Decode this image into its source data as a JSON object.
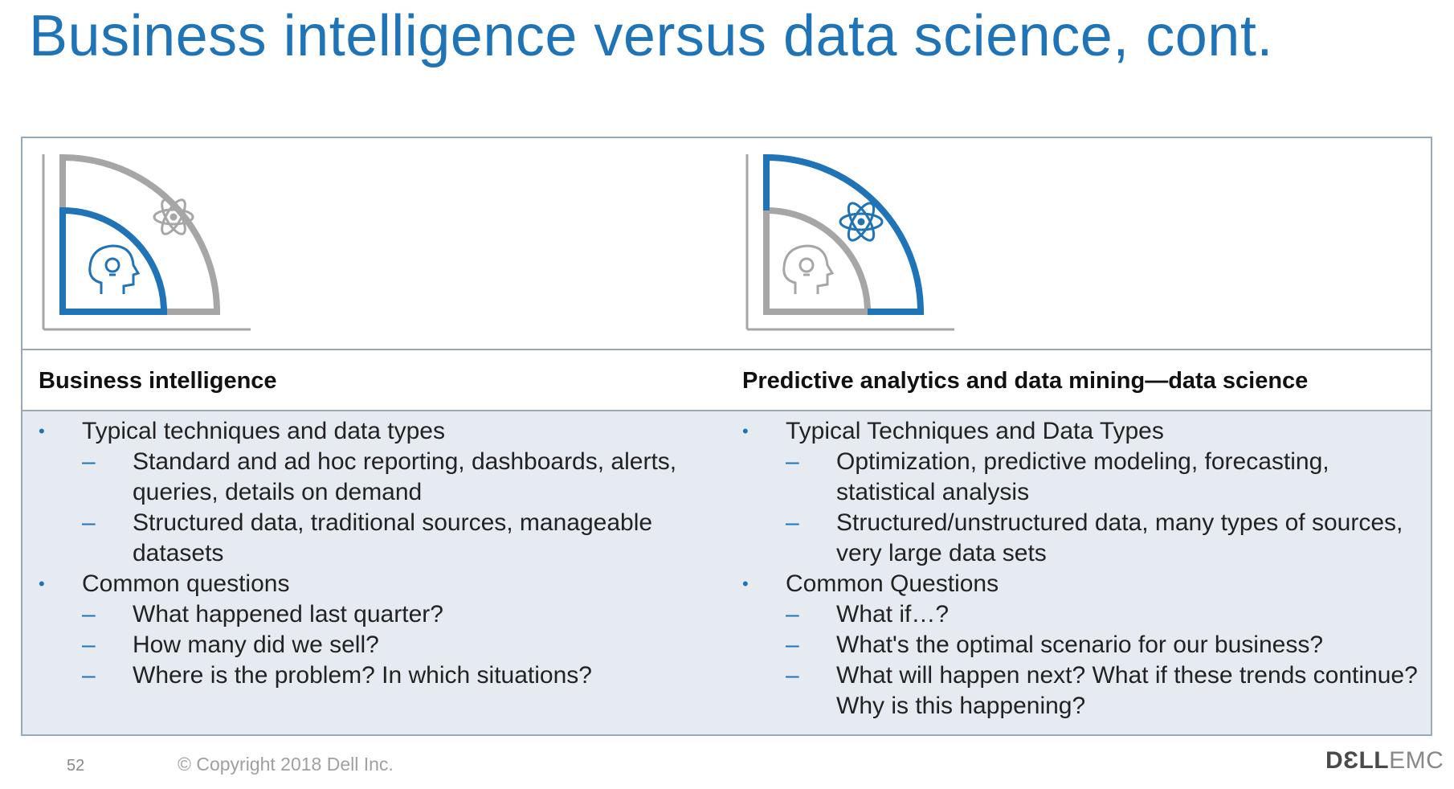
{
  "title": "Business intelligence versus data science, cont.",
  "colors": {
    "accent": "#1f73b7",
    "gray": "#a6a6a6",
    "band": "#e6ebf1"
  },
  "left": {
    "heading": "Business intelligence",
    "icon": "bi-quadrant-icon",
    "items": [
      {
        "text": "Typical techniques  and data types",
        "subitems": [
          "Standard and ad hoc reporting, dashboards, alerts, queries, details on demand",
          "Structured  data, traditional sources, manageable datasets"
        ]
      },
      {
        "text": "Common questions",
        "subitems": [
          "What happened last quarter?",
          "How many  did we sell?",
          "Where is the problem? In  which  situations?"
        ]
      }
    ]
  },
  "right": {
    "heading": "Predictive analytics and data mining—data science",
    "icon": "data-science-quadrant-icon",
    "items": [
      {
        "text": "Typical Techniques  and Data Types",
        "subitems": [
          "Optimization,  predictive modeling, forecasting, statistical analysis",
          "Structured/unstructured  data, many types of sources, very large data sets"
        ]
      },
      {
        "text": "Common Questions",
        "subitems": [
          "What if…?",
          "What's the optimal scenario for our business?",
          "What will happen next? What if these trends continue? Why is this happening?"
        ]
      }
    ]
  },
  "footer": {
    "page_number": "52",
    "copyright": "© Copyright 2018 Dell Inc.",
    "logo_dell": "DƐLL",
    "logo_emc": "EMC"
  }
}
